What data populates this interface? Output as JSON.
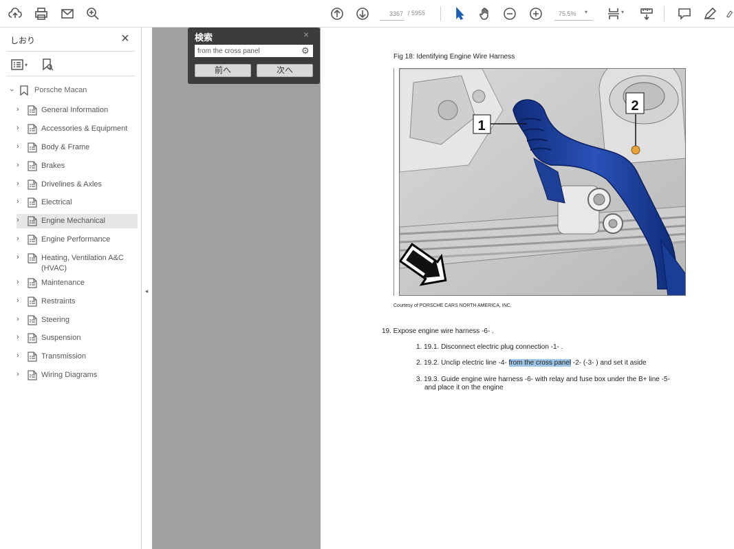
{
  "toolbar": {
    "page_current": "3367",
    "page_total": "/ 5955",
    "zoom": "75.5%",
    "icons": [
      "cloud-upload-icon",
      "print-icon",
      "mail-icon",
      "search-icon",
      "arrow-up-icon",
      "arrow-down-icon",
      "select-cursor-icon",
      "hand-icon",
      "zoom-out-icon",
      "zoom-in-icon",
      "fit-page-icon",
      "measure-icon",
      "comment-icon",
      "pen-icon",
      "highlight-icon"
    ]
  },
  "sidebar": {
    "title": "しおり",
    "close": "×",
    "root_label": "Porsche Macan",
    "items": [
      {
        "label": "General Information",
        "selected": false
      },
      {
        "label": "Accessories & Equipment",
        "selected": false
      },
      {
        "label": "Body & Frame",
        "selected": false
      },
      {
        "label": "Brakes",
        "selected": false
      },
      {
        "label": "Drivelines & Axles",
        "selected": false
      },
      {
        "label": "Electrical",
        "selected": false
      },
      {
        "label": "Engine Mechanical",
        "selected": true
      },
      {
        "label": "Engine Performance",
        "selected": false
      },
      {
        "label": "Heating, Ventilation A&C (HVAC)",
        "selected": false
      },
      {
        "label": "Maintenance",
        "selected": false
      },
      {
        "label": "Restraints",
        "selected": false
      },
      {
        "label": "Steering",
        "selected": false
      },
      {
        "label": "Suspension",
        "selected": false
      },
      {
        "label": "Transmission",
        "selected": false
      },
      {
        "label": "Wiring Diagrams",
        "selected": false
      }
    ]
  },
  "find": {
    "title": "検索",
    "close": "×",
    "query": "from the cross panel",
    "prev_label": "前へ",
    "next_label": "次へ"
  },
  "document": {
    "fig_caption": "Fig 18: Identifying Engine Wire Harness",
    "callout_1": "1",
    "callout_2": "2",
    "credit": "Courtesy of PORSCHE CARS NORTH AMERICA, INC.",
    "step": "19. Expose engine wire harness -6- .",
    "sub_steps": {
      "s1": "1. 19.1. Disconnect electric plug connection -1- .",
      "s2_pre": "2. 19.2. Unclip electric line -4- ",
      "s2_hl": "from the cross panel",
      "s2_post": " -2- (-3- ) and set it aside",
      "s3_line1": "3. 19.3. Guide engine wire harness -6- with relay and fuse box under the B+ line -5-",
      "s3_line2": "and place it on the engine"
    }
  },
  "colors": {
    "harness_blue": "#1a3d96",
    "highlight": "#9ec5e6",
    "gutter_gray": "#a0a0a0",
    "find_panel": "#3c3c3c"
  }
}
